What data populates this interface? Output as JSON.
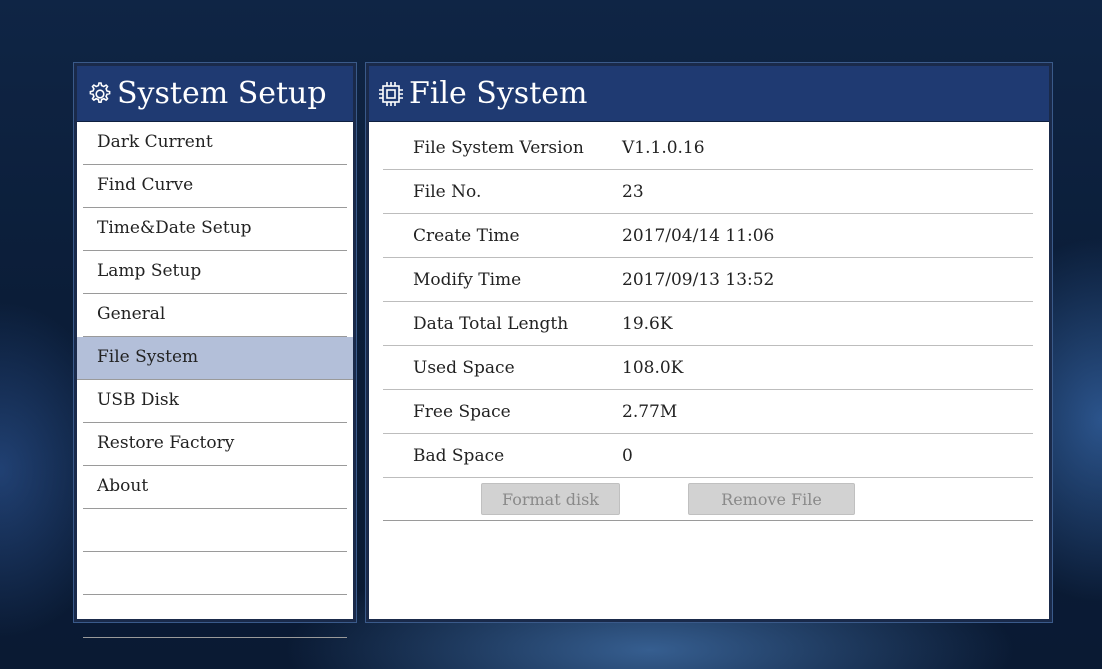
{
  "left_panel": {
    "title": "System Setup",
    "items": [
      {
        "label": "Dark Current"
      },
      {
        "label": "Find Curve"
      },
      {
        "label": "Time&Date Setup"
      },
      {
        "label": "Lamp Setup"
      },
      {
        "label": "General"
      },
      {
        "label": "File System",
        "selected": true
      },
      {
        "label": "USB Disk"
      },
      {
        "label": "Restore Factory"
      },
      {
        "label": "About"
      }
    ]
  },
  "right_panel": {
    "title": "File System",
    "rows": [
      {
        "label": "File System Version",
        "value": "V1.1.0.16"
      },
      {
        "label": "File No.",
        "value": "23"
      },
      {
        "label": "Create Time",
        "value": "2017/04/14 11:06"
      },
      {
        "label": "Modify Time",
        "value": "2017/09/13 13:52"
      },
      {
        "label": "Data Total Length",
        "value": "19.6K"
      },
      {
        "label": "Used Space",
        "value": "108.0K"
      },
      {
        "label": "Free Space",
        "value": "2.77M"
      },
      {
        "label": "Bad Space",
        "value": "0"
      }
    ],
    "buttons": {
      "format_disk": "Format disk",
      "remove_file": "Remove File"
    }
  },
  "icons": {
    "left_header": "gear-icon",
    "right_header": "chip-icon"
  },
  "colors": {
    "header_bg": "#1f3a72",
    "selected_bg": "#b3bfd9",
    "button_bg": "#d2d2d2"
  }
}
